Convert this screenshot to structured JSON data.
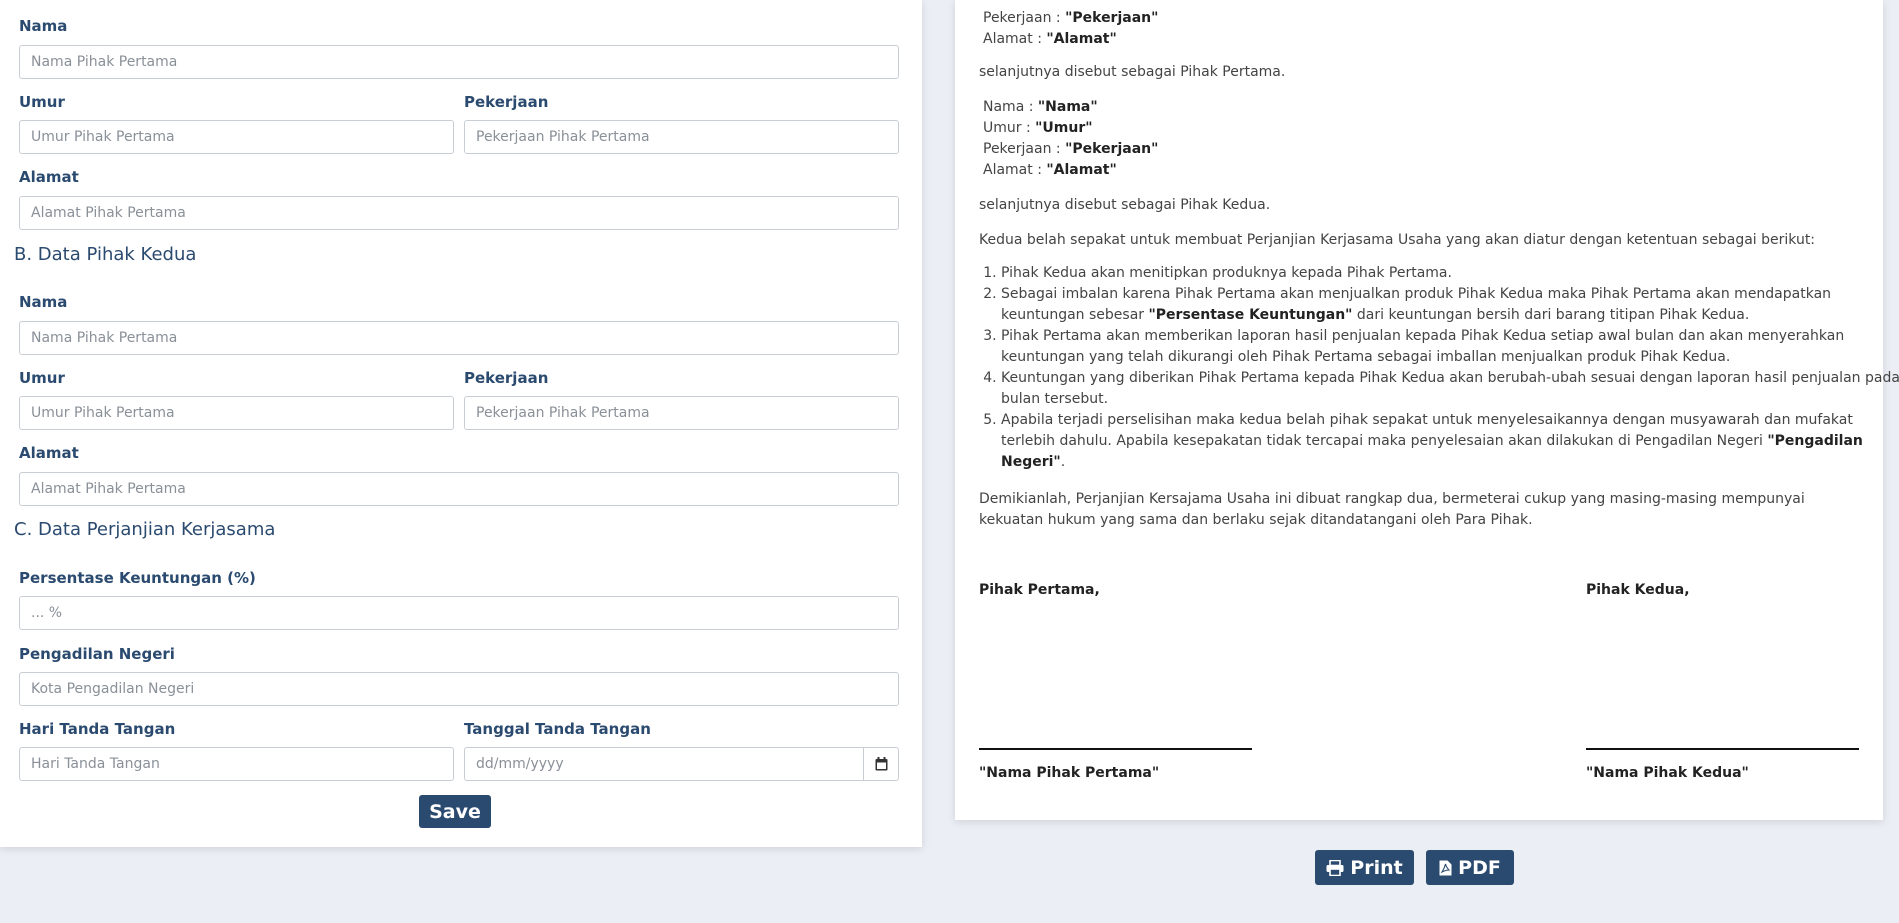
{
  "form": {
    "first_party": {
      "nama_label": "Nama",
      "nama_placeholder": "Nama Pihak Pertama",
      "umur_label": "Umur",
      "umur_placeholder": "Umur Pihak Pertama",
      "pekerjaan_label": "Pekerjaan",
      "pekerjaan_placeholder": "Pekerjaan Pihak Pertama",
      "alamat_label": "Alamat",
      "alamat_placeholder": "Alamat Pihak Pertama"
    },
    "second_party": {
      "title": "B. Data Pihak Kedua",
      "nama_label": "Nama",
      "nama_placeholder": "Nama Pihak Pertama",
      "umur_label": "Umur",
      "umur_placeholder": "Umur Pihak Pertama",
      "pekerjaan_label": "Pekerjaan",
      "pekerjaan_placeholder": "Pekerjaan Pihak Pertama",
      "alamat_label": "Alamat",
      "alamat_placeholder": "Alamat Pihak Pertama"
    },
    "agreement": {
      "title": "C. Data Perjanjian Kerjasama",
      "persentase_label": "Persentase Keuntungan (%)",
      "persentase_placeholder": "... %",
      "pengadilan_label": "Pengadilan Negeri",
      "pengadilan_placeholder": "Kota Pengadilan Negeri",
      "hari_label": "Hari Tanda Tangan",
      "hari_placeholder": "Hari Tanda Tangan",
      "tanggal_label": "Tanggal Tanda Tangan",
      "tanggal_placeholder": "dd/mm/yyyy"
    },
    "save_label": "Save"
  },
  "document": {
    "party1": {
      "pekerjaan_key": "Pekerjaan : ",
      "pekerjaan_val": "\"Pekerjaan\"",
      "alamat_key": "Alamat : ",
      "alamat_val": "\"Alamat\""
    },
    "party1_closing": "selanjutnya disebut sebagai Pihak Pertama.",
    "party2": {
      "nama_key": "Nama : ",
      "nama_val": "\"Nama\"",
      "umur_key": "Umur : ",
      "umur_val": "\"Umur\"",
      "pekerjaan_key": "Pekerjaan : ",
      "pekerjaan_val": "\"Pekerjaan\"",
      "alamat_key": "Alamat : ",
      "alamat_val": "\"Alamat\""
    },
    "party2_closing": "selanjutnya disebut sebagai Pihak Kedua.",
    "intro": "Kedua belah sepakat untuk membuat Perjanjian Kerjasama Usaha yang akan diatur dengan ketentuan sebagai berikut:",
    "terms": {
      "t1": "Pihak Kedua akan menitipkan produknya kepada Pihak Pertama.",
      "t2_a": "Sebagai imbalan karena Pihak Pertama akan menjualkan produk Pihak Kedua maka Pihak Pertama akan mendapatkan keuntungan sebesar ",
      "t2_b": "\"Persentase Keuntungan\"",
      "t2_c": " dari keuntungan bersih dari barang titipan Pihak Kedua.",
      "t3": "Pihak Pertama akan memberikan laporan hasil penjualan kepada Pihak Kedua setiap awal bulan dan akan menyerahkan keuntungan yang telah dikurangi oleh Pihak Pertama sebagai imballan menjualkan produk Pihak Kedua.",
      "t4": "Keuntungan yang diberikan Pihak Pertama kepada Pihak Kedua akan berubah-ubah sesuai dengan laporan hasil penjualan pada bulan tersebut.",
      "t5_a": "Apabila terjadi perselisihan maka kedua belah pihak sepakat untuk menyelesaikannya dengan musyawarah dan mufakat terlebih dahulu. Apabila kesepakatan tidak tercapai maka penyelesaian akan dilakukan di Pengadilan Negeri ",
      "t5_b": "\"Pengadilan Negeri\"",
      "t5_c": "."
    },
    "closing": "Demikianlah, Perjanjian Kersajama Usaha ini dibuat rangkap dua, bermeterai cukup yang masing-masing mempunyai kekuatan hukum yang sama dan berlaku sejak ditandatangani oleh Para Pihak.",
    "sign_first_label": "Pihak Pertama,",
    "sign_second_label": "Pihak Kedua,",
    "sign_first_name": "\"Nama Pihak Pertama\"",
    "sign_second_name": "\"Nama Pihak Kedua\""
  },
  "actions": {
    "print_label": "Print",
    "pdf_label": "PDF"
  },
  "icons": {
    "calendar": "calendar-icon",
    "print": "printer-icon",
    "pdf": "file-pdf-icon"
  },
  "colors": {
    "primary": "#2b4a6f",
    "background": "#ebeff5"
  }
}
